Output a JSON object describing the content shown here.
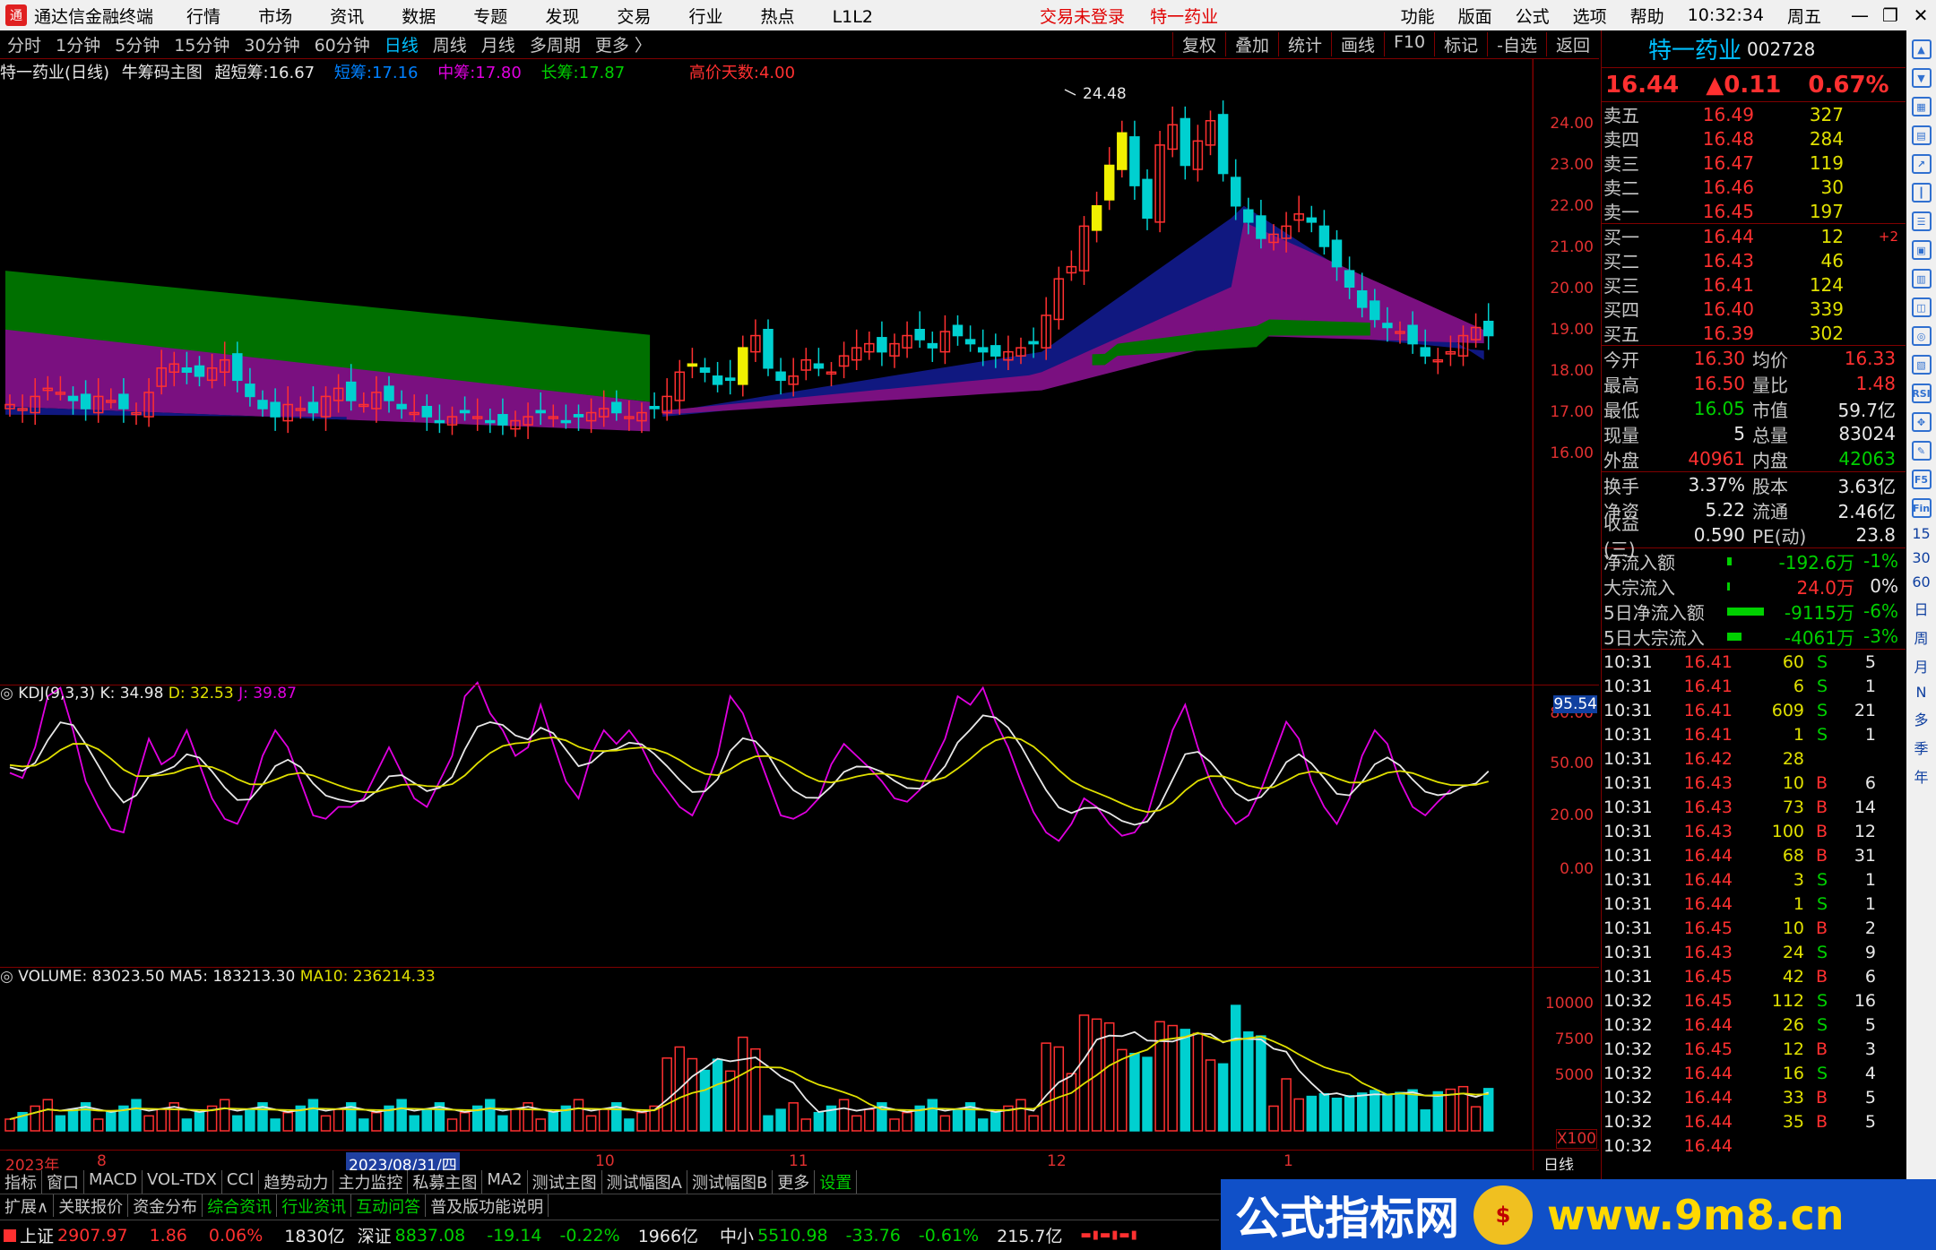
{
  "titlebar": {
    "app": "通达信金融终端",
    "menu": [
      "行情",
      "市场",
      "资讯",
      "数据",
      "专题",
      "发现",
      "交易",
      "行业",
      "热点",
      "L1L2"
    ],
    "login": "交易未登录",
    "stock": "特一药业",
    "right_menu": [
      "功能",
      "版面",
      "公式",
      "选项",
      "帮助"
    ],
    "time": "10:32:34",
    "weekday": "周五"
  },
  "toolbar": {
    "periods": [
      "分时",
      "1分钟",
      "5分钟",
      "15分钟",
      "30分钟",
      "60分钟",
      "日线",
      "周线",
      "月线",
      "多周期",
      "更多 〉"
    ],
    "active": "日线",
    "tools": [
      "复权",
      "叠加",
      "统计",
      "画线",
      "F10",
      "标记",
      "-自选",
      "返回"
    ]
  },
  "info": {
    "name": "特一药业(日线)",
    "indicator": "牛筹码主图",
    "ultra_label": "超短筹:",
    "ultra": "16.67",
    "short_label": "短筹:",
    "short": "17.16",
    "mid_label": "中筹:",
    "mid": "17.80",
    "long_label": "长筹:",
    "long": "17.87",
    "high_days_label": "高价天数:",
    "high_days": "4.00"
  },
  "price_axis": [
    "24.00",
    "23.00",
    "22.00",
    "21.00",
    "20.00",
    "19.00",
    "18.00",
    "17.00",
    "16.00"
  ],
  "peak_label": "24.48",
  "kdj": {
    "title": "KDJ(9,3,3)",
    "k": "K: 34.98",
    "d": "D: 32.53",
    "j": "J: 39.87",
    "axis": [
      "80.00",
      "50.00",
      "20.00",
      "0.00"
    ],
    "marker": "95.54"
  },
  "volume": {
    "title": "VOLUME: 83023.50",
    "ma5": "MA5: 183213.30",
    "ma10": "MA10: 236214.33",
    "axis": [
      "10000",
      "7500",
      "5000"
    ],
    "unit": "X100"
  },
  "xaxis": {
    "labels": [
      "2023年",
      "8",
      "2023/08/31/四",
      "10",
      "11",
      "12",
      "1"
    ],
    "period": "日线"
  },
  "tabs": [
    "指标",
    "窗口",
    "MACD",
    "VOL-TDX",
    "CCI",
    "趋势动力",
    "主力监控",
    "私募主图",
    "MA2",
    "测试主图",
    "测试幅图A",
    "测试幅图B",
    "更多",
    "设置"
  ],
  "tabs2": [
    "扩展∧",
    "关联报价",
    "资金分布",
    "综合资讯",
    "行业资讯",
    "互动问答",
    "普及版功能说明"
  ],
  "status": {
    "sh": "上证",
    "sh_v": "2907.97",
    "sh_c": "1.86",
    "sh_p": "0.06%",
    "sh_a": "1830亿",
    "sz": "深证",
    "sz_v": "8837.08",
    "sz_c": "-19.14",
    "sz_p": "-0.22%",
    "sz_a": "1966亿",
    "zx": "中小",
    "zx_v": "5510.98",
    "zx_c": "-33.76",
    "zx_p": "-0.61%",
    "zx_a": "215.7亿"
  },
  "quote": {
    "name": "特一药业",
    "code": "002728",
    "price": "16.44",
    "change": "▲0.11",
    "pct": "0.67%"
  },
  "orderbook": {
    "asks": [
      {
        "label": "卖五",
        "price": "16.49",
        "vol": "327"
      },
      {
        "label": "卖四",
        "price": "16.48",
        "vol": "284"
      },
      {
        "label": "卖三",
        "price": "16.47",
        "vol": "119"
      },
      {
        "label": "卖二",
        "price": "16.46",
        "vol": "30"
      },
      {
        "label": "卖一",
        "price": "16.45",
        "vol": "197"
      }
    ],
    "bids": [
      {
        "label": "买一",
        "price": "16.44",
        "vol": "12",
        "chg": "+2"
      },
      {
        "label": "买二",
        "price": "16.43",
        "vol": "46",
        "chg": ""
      },
      {
        "label": "买三",
        "price": "16.41",
        "vol": "124",
        "chg": ""
      },
      {
        "label": "买四",
        "price": "16.40",
        "vol": "339",
        "chg": ""
      },
      {
        "label": "买五",
        "price": "16.39",
        "vol": "302",
        "chg": ""
      }
    ]
  },
  "stats1": [
    [
      "今开",
      "16.30",
      "均价",
      "16.33"
    ],
    [
      "最高",
      "16.50",
      "量比",
      "1.48"
    ],
    [
      "最低",
      "16.05",
      "市值",
      "59.7亿"
    ],
    [
      "现量",
      "5",
      "总量",
      "83024"
    ],
    [
      "外盘",
      "40961",
      "内盘",
      "42063"
    ]
  ],
  "stats2": [
    [
      "换手",
      "3.37%",
      "股本",
      "3.63亿"
    ],
    [
      "净资",
      "5.22",
      "流通",
      "2.46亿"
    ],
    [
      "收益(三)",
      "0.590",
      "PE(动)",
      "23.8"
    ]
  ],
  "flows": [
    {
      "label": "净流入额",
      "value": "-192.6万",
      "pct": "-1%",
      "bar": 0.04
    },
    {
      "label": "大宗流入",
      "value": "24.0万",
      "pct": "0%",
      "bar": 0.02
    },
    {
      "label": "5日净流入额",
      "value": "-9115万",
      "pct": "-6%",
      "bar": 0.55
    },
    {
      "label": "5日大宗流入",
      "value": "-4061万",
      "pct": "-3%",
      "bar": 0.2
    }
  ],
  "ticks": [
    [
      "10:31",
      "16.41",
      "60",
      "S",
      "5"
    ],
    [
      "10:31",
      "16.41",
      "6",
      "S",
      "1"
    ],
    [
      "10:31",
      "16.41",
      "609",
      "S",
      "21"
    ],
    [
      "10:31",
      "16.41",
      "1",
      "S",
      "1"
    ],
    [
      "10:31",
      "16.42",
      "28",
      "",
      ""
    ],
    [
      "10:31",
      "16.43",
      "10",
      "B",
      "6"
    ],
    [
      "10:31",
      "16.43",
      "73",
      "B",
      "14"
    ],
    [
      "10:31",
      "16.43",
      "100",
      "B",
      "12"
    ],
    [
      "10:31",
      "16.44",
      "68",
      "B",
      "31"
    ],
    [
      "10:31",
      "16.44",
      "3",
      "S",
      "1"
    ],
    [
      "10:31",
      "16.44",
      "1",
      "S",
      "1"
    ],
    [
      "10:31",
      "16.45",
      "10",
      "B",
      "2"
    ],
    [
      "10:31",
      "16.43",
      "24",
      "S",
      "9"
    ],
    [
      "10:31",
      "16.45",
      "42",
      "B",
      "6"
    ],
    [
      "10:32",
      "16.45",
      "112",
      "S",
      "16"
    ],
    [
      "10:32",
      "16.44",
      "26",
      "S",
      "5"
    ],
    [
      "10:32",
      "16.45",
      "12",
      "B",
      "3"
    ],
    [
      "10:32",
      "16.44",
      "16",
      "S",
      "4"
    ],
    [
      "10:32",
      "16.44",
      "33",
      "B",
      "5"
    ],
    [
      "10:32",
      "16.44",
      "35",
      "B",
      "5"
    ],
    [
      "10:32",
      "16.44",
      "",
      "",
      ""
    ]
  ],
  "sidebar_text": [
    "日",
    "周",
    "月",
    "N",
    "多",
    "季",
    "年"
  ],
  "sidebar_icons": [
    "RSI",
    "F5",
    "Fin",
    "15",
    "30",
    "60"
  ],
  "watermark": {
    "text": "公式指标网",
    "url": "www.9m8.cn"
  },
  "colors": {
    "up": "#ff3030",
    "down": "#00d0d0",
    "long": "#007000",
    "mid": "#7a1080",
    "short": "#101880"
  }
}
